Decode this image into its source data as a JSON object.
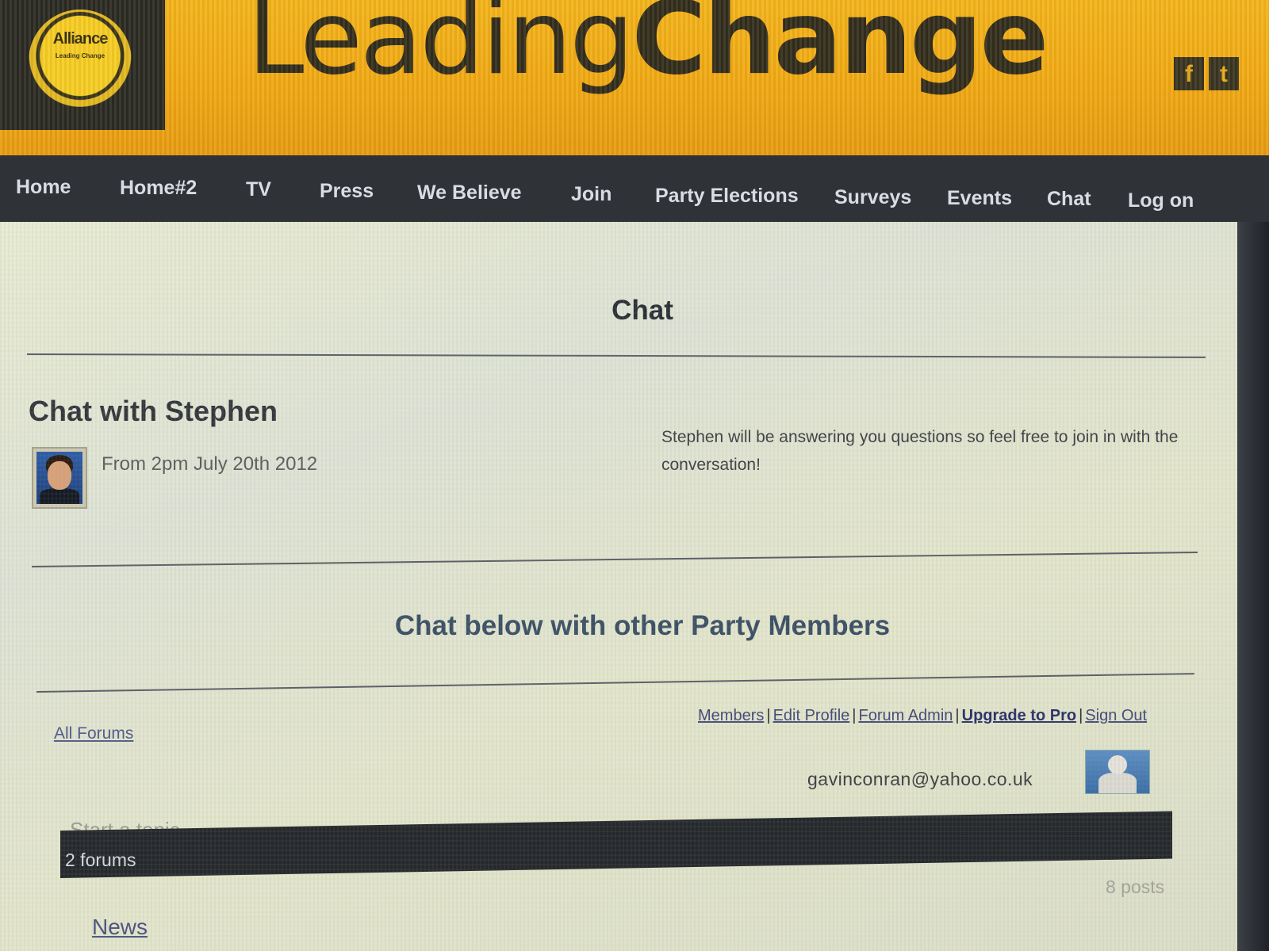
{
  "header": {
    "logo_text": "Alliance",
    "logo_subtext": "Leading Change",
    "title_light": "Leading",
    "title_bold": "Change",
    "social": [
      {
        "icon": "facebook-icon",
        "glyph": "f"
      },
      {
        "icon": "twitter-icon",
        "glyph": "t"
      }
    ]
  },
  "nav": {
    "items": [
      "Home",
      "Home#2",
      "TV",
      "Press",
      "We Believe",
      "Join",
      "Party Elections",
      "Surveys",
      "Events",
      "Chat",
      "Log on"
    ]
  },
  "main": {
    "page_title": "Chat",
    "event": {
      "title": "Chat with Stephen",
      "date": "From 2pm July 20th 2012",
      "description": "Stephen will be answering you questions so feel free to join in with the conversation!"
    },
    "sub_heading": "Chat below with other Party Members"
  },
  "forum": {
    "all_forums": "All Forums",
    "links": {
      "members": "Members",
      "edit_profile": "Edit Profile",
      "forum_admin": "Forum Admin",
      "upgrade": "Upgrade to Pro",
      "sign_out": "Sign Out",
      "separator": "|"
    },
    "user_email": "gavinconran@yahoo.co.uk",
    "start_topic": "Start a topic",
    "forums_count": "2 forums",
    "posts_count": "8 posts",
    "first_forum": "News"
  },
  "colors": {
    "header_bg": "#f0a812",
    "nav_bg": "#2f3236",
    "panel_bg": "#e3e6d0",
    "link": "#434a7a"
  }
}
